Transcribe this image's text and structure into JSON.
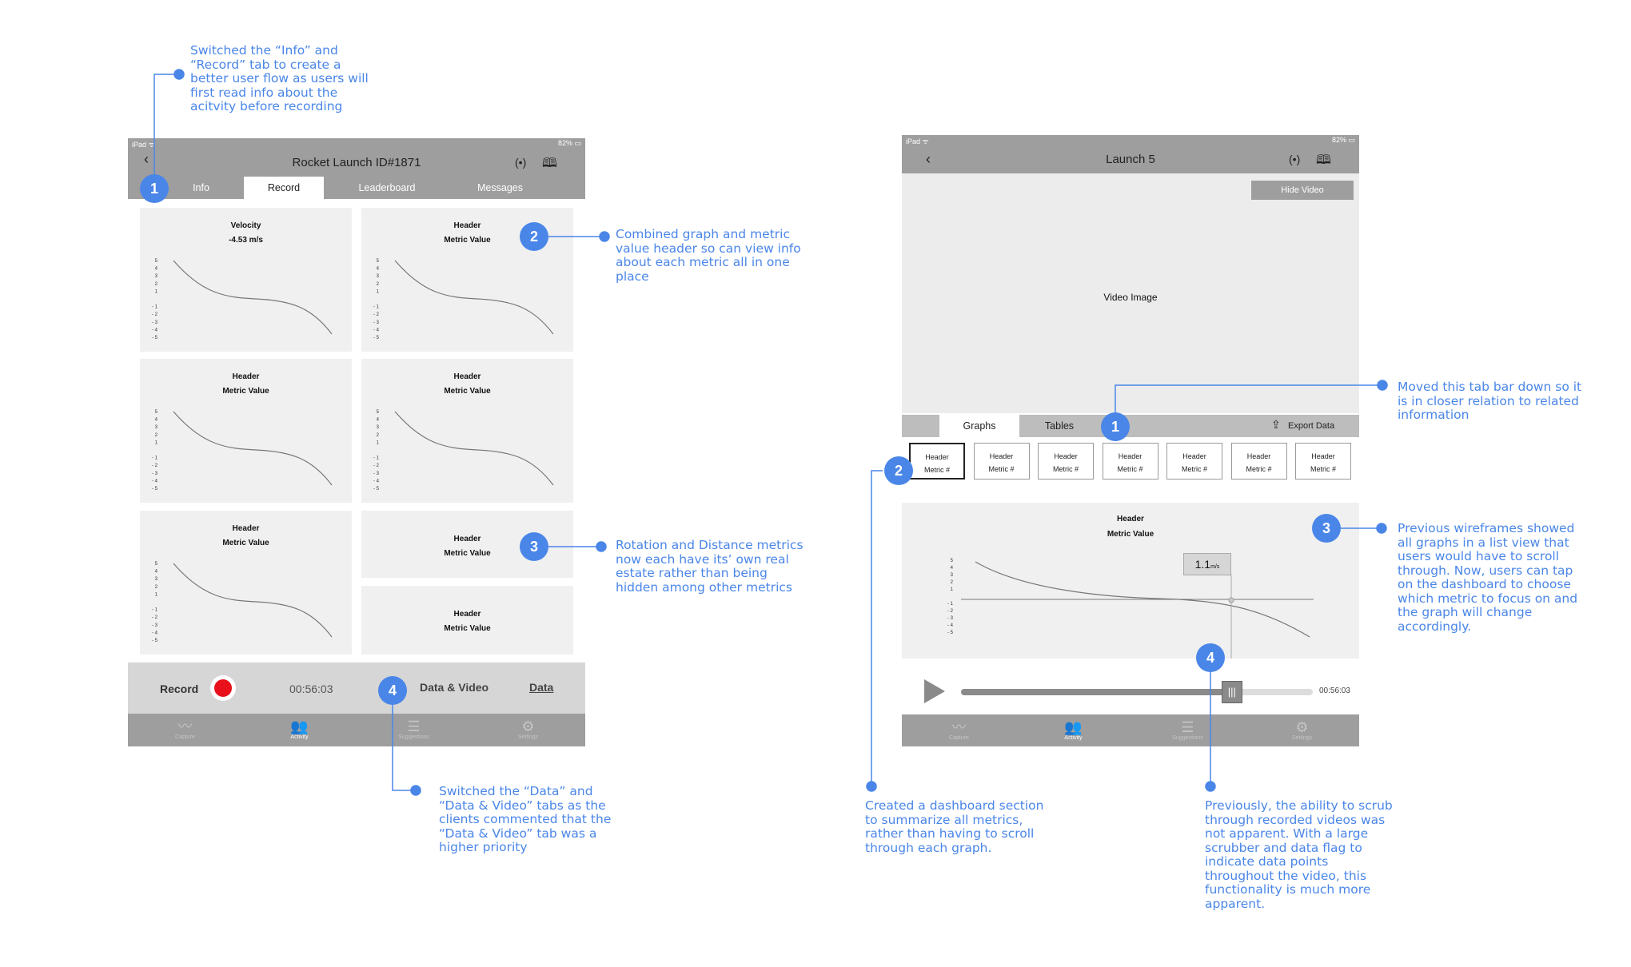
{
  "left_device": {
    "status": {
      "left": "iPad ᯤ",
      "right": "82% ▭"
    },
    "title": "Rocket Launch ID#1871",
    "back": "‹",
    "tabs": [
      {
        "label": "Info"
      },
      {
        "label": "Record"
      },
      {
        "label": "Leaderboard"
      },
      {
        "label": "Messages"
      }
    ],
    "cards": [
      {
        "header": "Velocity",
        "value": "-4.53 m/s"
      },
      {
        "header": "Header",
        "value": "Metric Value"
      },
      {
        "header": "Header",
        "value": "Metric Value"
      },
      {
        "header": "Header",
        "value": "Metric Value"
      },
      {
        "header": "Header",
        "value": "Metric Value"
      },
      {
        "header": "Header",
        "value": "Metric Value"
      },
      {
        "header": "Header",
        "value": "Metric Value"
      }
    ],
    "axis_ticks": [
      "5",
      "4",
      "3",
      "2",
      "1",
      "",
      "- 1",
      "- 2",
      "- 3",
      "- 4",
      "- 5"
    ],
    "record_label": "Record",
    "timer": "00:56:03",
    "mode_data_video": "Data & Video",
    "mode_data": "Data",
    "tabbar": [
      "Capture",
      "Activity",
      "Suggestions",
      "Settings"
    ]
  },
  "right_device": {
    "status": {
      "left": "iPad ᯤ",
      "right": "82% ▭"
    },
    "title": "Launch 5",
    "back": "‹",
    "hide_video": "Hide Video",
    "video_label": "Video Image",
    "tabs": [
      {
        "label": "Graphs"
      },
      {
        "label": "Tables"
      }
    ],
    "export": "Export Data",
    "metrics": [
      {
        "header": "Header",
        "value": "Metric #"
      },
      {
        "header": "Header",
        "value": "Metric #"
      },
      {
        "header": "Header",
        "value": "Metric #"
      },
      {
        "header": "Header",
        "value": "Metric #"
      },
      {
        "header": "Header",
        "value": "Metric #"
      },
      {
        "header": "Header",
        "value": "Metric #"
      },
      {
        "header": "Header",
        "value": "Metric #"
      }
    ],
    "graph_header": "Header",
    "graph_value": "Metric Value",
    "flag_value": "1.1",
    "flag_unit": "m/s",
    "axis_ticks": [
      "5",
      "4",
      "3",
      "2",
      "1",
      "",
      "- 1",
      "- 2",
      "- 3",
      "- 4",
      "- 5"
    ],
    "scrub_time": "00:56:03",
    "scrub_progress": 0.77,
    "tabbar": [
      "Capture",
      "Activity",
      "Suggestions",
      "Settings"
    ]
  },
  "annotations": {
    "left_1": "Switched the “Info” and\n“Record” tab to create a\nbetter user flow as users will\nfirst read info about the\nacitvity before recording",
    "left_2": "Combined graph and metric\nvalue header so can view info\nabout each metric all in one\nplace",
    "left_3": "Rotation and Distance metrics\nnow each have its’ own real\nestate rather than being\nhidden among other metrics",
    "left_4": "Switched the “Data” and\n“Data & Video” tabs as the\nclients commented that the\n“Data & Video” tab was a\nhigher priority",
    "right_1": "Moved this tab bar down so it\nis in closer relation to related\ninformation",
    "right_2": "Created a dashboard section\nto summarize all metrics,\nrather than having to scroll\nthrough each graph.",
    "right_3": "Previous wireframes showed\nall graphs in a list view that\nusers would have to scroll\nthrough. Now, users can tap\non the dashboard to choose\nwhich metric to focus on and\nthe graph will change\naccordingly.",
    "right_4": "Previously, the ability to scrub\nthrough recorded videos was\nnot apparent. With a large\nscrubber and data flag to\nindicate data points\nthroughout the video, this\nfunctionality is much more\napparent."
  },
  "badges": [
    "1",
    "2",
    "3",
    "4",
    "1",
    "2",
    "3",
    "4"
  ],
  "colors": {
    "accent": "#4a86e8",
    "record": "#e8101b",
    "bar": "#9e9e9e"
  }
}
